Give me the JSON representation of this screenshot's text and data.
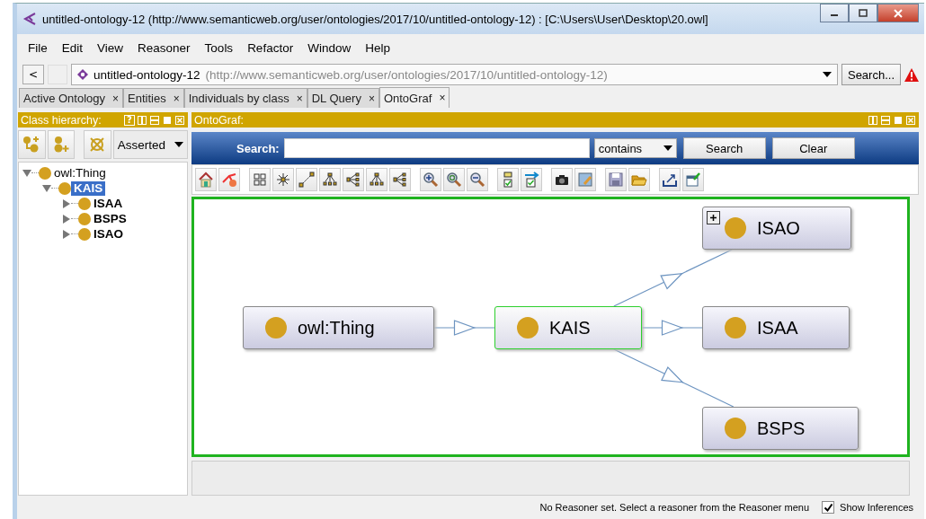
{
  "window": {
    "title": "untitled-ontology-12 (http://www.semanticweb.org/user/ontologies/2017/10/untitled-ontology-12)  : [C:\\Users\\User\\Desktop\\20.owl]"
  },
  "menu": [
    "File",
    "Edit",
    "View",
    "Reasoner",
    "Tools",
    "Refactor",
    "Window",
    "Help"
  ],
  "address": {
    "back": "<",
    "name": "untitled-ontology-12",
    "iri": "(http://www.semanticweb.org/user/ontologies/2017/10/untitled-ontology-12)",
    "search_button": "Search..."
  },
  "tabs": [
    {
      "label": "Active Ontology",
      "close": "×",
      "selected": false
    },
    {
      "label": "Entities",
      "close": "×",
      "selected": false
    },
    {
      "label": "Individuals by class",
      "close": "×",
      "selected": false
    },
    {
      "label": "DL Query",
      "close": "×",
      "selected": false
    },
    {
      "label": "OntoGraf",
      "close": "×",
      "selected": true
    }
  ],
  "class_hierarchy": {
    "title": "Class hierarchy:",
    "help": "?",
    "mode": "Asserted",
    "tree": [
      {
        "label": "owl:Thing",
        "expanded": true,
        "selected": false,
        "children": [
          {
            "label": "KAIS",
            "expanded": true,
            "selected": true,
            "children": [
              {
                "label": "ISAA",
                "expanded": false,
                "selected": false
              },
              {
                "label": "BSPS",
                "expanded": false,
                "selected": false
              },
              {
                "label": "ISAO",
                "expanded": false,
                "selected": false
              }
            ]
          }
        ]
      }
    ]
  },
  "ontograf": {
    "title": "OntoGraf:",
    "search_label": "Search:",
    "match": "contains",
    "search_button": "Search",
    "clear_button": "Clear",
    "graph": [
      {
        "label": "owl:Thing",
        "selected": false,
        "expandable": false,
        "children": [
          {
            "label": "KAIS",
            "selected": true,
            "expandable": false,
            "children": [
              {
                "label": "ISAO",
                "selected": false,
                "expandable": true
              },
              {
                "label": "ISAA",
                "selected": false,
                "expandable": false
              },
              {
                "label": "BSPS",
                "selected": false,
                "expandable": false
              }
            ]
          }
        ]
      }
    ]
  },
  "status_bar": {
    "message": "No Reasoner set. Select a reasoner from the Reasoner menu",
    "show_inferences": {
      "label": "Show Inferences",
      "checked": true
    }
  }
}
